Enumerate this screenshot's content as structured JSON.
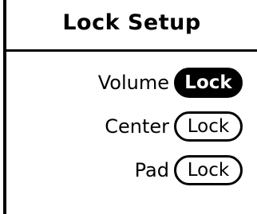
{
  "screen": {
    "title": "Lock Setup"
  },
  "rows": [
    {
      "label": "Volume",
      "button": "Lock",
      "selected": true
    },
    {
      "label": "Center",
      "button": "Lock",
      "selected": false
    },
    {
      "label": "Pad",
      "button": "Lock",
      "selected": false
    }
  ],
  "colors": {
    "background": "#ffffff",
    "foreground": "#000000"
  }
}
